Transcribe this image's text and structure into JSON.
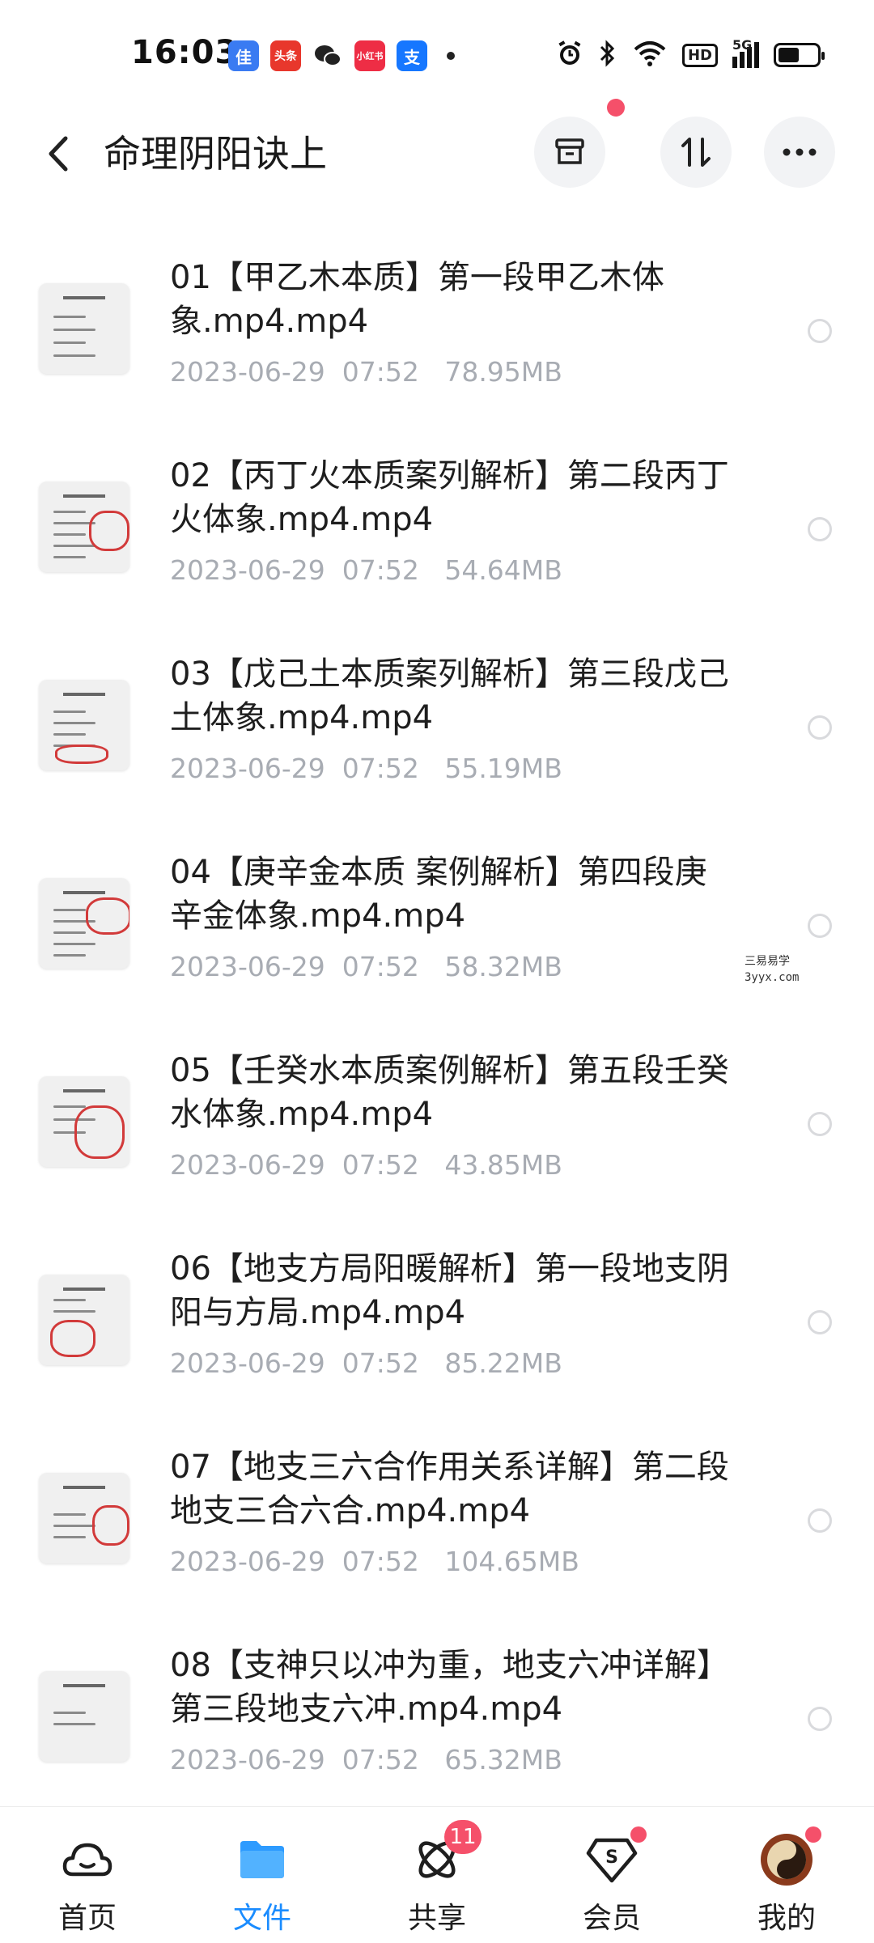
{
  "status_bar": {
    "time": "16:03",
    "app_icons": [
      {
        "name": "app-icon-1",
        "label": "佳",
        "color": "#3a7bf2"
      },
      {
        "name": "toutiao-icon",
        "label": "头条",
        "color": "#e8372c"
      },
      {
        "name": "wechat-icon",
        "label": "",
        "color": "#222222"
      },
      {
        "name": "xiaohongshu-icon",
        "label": "小红书",
        "color": "#ee2d45"
      },
      {
        "name": "alipay-icon",
        "label": "支",
        "color": "#1677ff"
      }
    ],
    "battery_percent": 0.55,
    "network_label": "5G",
    "hd_label": "HD"
  },
  "header": {
    "title": "命理阴阳诀上"
  },
  "files": [
    {
      "name": "01【甲乙木本质】第一段甲乙木体象.mp4.mp4",
      "date": "2023-06-29",
      "time": "07:52",
      "size": "78.95MB"
    },
    {
      "name": "02【丙丁火本质案列解析】第二段丙丁火体象.mp4.mp4",
      "date": "2023-06-29",
      "time": "07:52",
      "size": "54.64MB"
    },
    {
      "name": "03【戊己土本质案列解析】第三段戊己土体象.mp4.mp4",
      "date": "2023-06-29",
      "time": "07:52",
      "size": "55.19MB"
    },
    {
      "name": "04【庚辛金本质 案例解析】第四段庚辛金体象.mp4.mp4",
      "date": "2023-06-29",
      "time": "07:52",
      "size": "58.32MB"
    },
    {
      "name": "05【壬癸水本质案例解析】第五段壬癸水体象.mp4.mp4",
      "date": "2023-06-29",
      "time": "07:52",
      "size": "43.85MB"
    },
    {
      "name": "06【地支方局阳暖解析】第一段地支阴阳与方局.mp4.mp4",
      "date": "2023-06-29",
      "time": "07:52",
      "size": "85.22MB"
    },
    {
      "name": "07【地支三六合作用关系详解】第二段地支三合六合.mp4.mp4",
      "date": "2023-06-29",
      "time": "07:52",
      "size": "104.65MB"
    },
    {
      "name": "08【支神只以冲为重，地支六冲详解】第三段地支六冲.mp4.mp4",
      "date": "2023-06-29",
      "time": "07:52",
      "size": "65.32MB"
    }
  ],
  "watermark": {
    "line1": "三易易学",
    "line2": "3yyx.com"
  },
  "nav": {
    "items": [
      {
        "label": "首页"
      },
      {
        "label": "文件"
      },
      {
        "label": "共享",
        "badge": "11"
      },
      {
        "label": "会员"
      },
      {
        "label": "我的"
      }
    ],
    "active": "文件"
  },
  "colors": {
    "accent": "#1a8cff",
    "badge": "#f5506a",
    "meta": "#a8acb3"
  }
}
